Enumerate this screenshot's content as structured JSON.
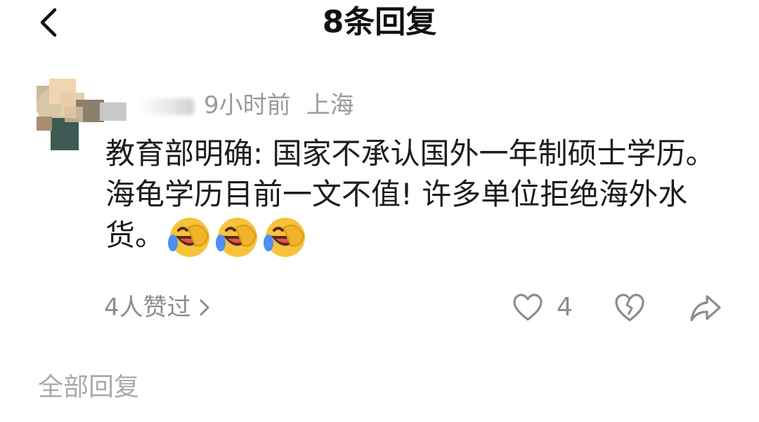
{
  "header": {
    "title": "8条回复",
    "back_icon": "chevron-left-icon"
  },
  "reply": {
    "time": "9小时前",
    "location": "上海",
    "text": "教育部明确: 国家不承认国外一年制硕士学历。海龟学历目前一文不值! 许多单位拒绝海外水货。",
    "emojis": [
      "laughing-crying-emoji",
      "laughing-crying-emoji",
      "laughing-crying-emoji"
    ],
    "likers_label": "4人赞过",
    "like_count": "4",
    "icons": {
      "like": "heart-icon",
      "dislike": "broken-heart-icon",
      "share": "share-arrow-icon",
      "more": "chevron-right-icon"
    }
  },
  "section": {
    "all_replies_label": "全部回复"
  },
  "colors": {
    "text_primary": "#1c1c1c",
    "text_secondary": "#9a9a9a",
    "emoji_yellow": "#f6c33b",
    "emoji_blue": "#4f8ff2"
  }
}
